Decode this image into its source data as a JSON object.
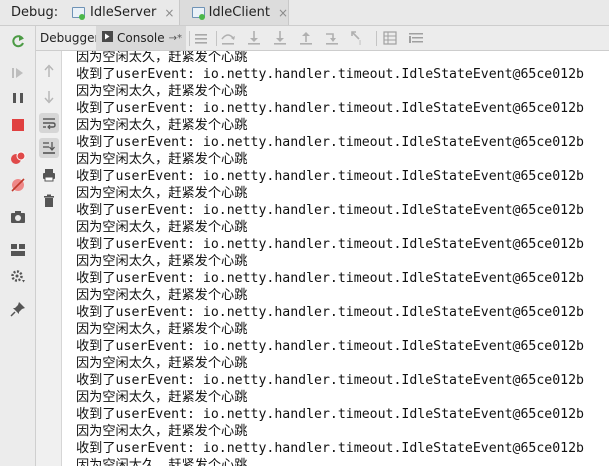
{
  "header": {
    "debug_label": "Debug:",
    "tabs": [
      {
        "label": "IdleServer",
        "active": false
      },
      {
        "label": "IdleClient",
        "active": true
      }
    ],
    "close_glyph": "×"
  },
  "subtoolbar": {
    "debugger_label": "Debugger",
    "console_label": "Console",
    "console_suffix": "→*"
  },
  "console": {
    "lines": [
      "因为空闲太久，赶紧发个心跳",
      "收到了userEvent: io.netty.handler.timeout.IdleStateEvent@65ce012b",
      "因为空闲太久，赶紧发个心跳",
      "收到了userEvent: io.netty.handler.timeout.IdleStateEvent@65ce012b",
      "因为空闲太久，赶紧发个心跳",
      "收到了userEvent: io.netty.handler.timeout.IdleStateEvent@65ce012b",
      "因为空闲太久，赶紧发个心跳",
      "收到了userEvent: io.netty.handler.timeout.IdleStateEvent@65ce012b",
      "因为空闲太久，赶紧发个心跳",
      "收到了userEvent: io.netty.handler.timeout.IdleStateEvent@65ce012b",
      "因为空闲太久，赶紧发个心跳",
      "收到了userEvent: io.netty.handler.timeout.IdleStateEvent@65ce012b",
      "因为空闲太久，赶紧发个心跳",
      "收到了userEvent: io.netty.handler.timeout.IdleStateEvent@65ce012b",
      "因为空闲太久，赶紧发个心跳",
      "收到了userEvent: io.netty.handler.timeout.IdleStateEvent@65ce012b",
      "因为空闲太久，赶紧发个心跳",
      "收到了userEvent: io.netty.handler.timeout.IdleStateEvent@65ce012b",
      "因为空闲太久，赶紧发个心跳",
      "收到了userEvent: io.netty.handler.timeout.IdleStateEvent@65ce012b",
      "因为空闲太久，赶紧发个心跳",
      "收到了userEvent: io.netty.handler.timeout.IdleStateEvent@65ce012b",
      "因为空闲太久，赶紧发个心跳",
      "收到了userEvent: io.netty.handler.timeout.IdleStateEvent@65ce012b",
      "因为空闲太久，赶紧发个心跳"
    ]
  },
  "colors": {
    "resume_green": "#4c9b45",
    "stop_red": "#e04040",
    "breakpoint_red": "#e04a4a",
    "tab_dot_green": "#4bb84b"
  },
  "icons": {
    "left_strip": [
      "rerun-icon",
      "resume-icon",
      "pause-icon",
      "stop-icon",
      "view-breakpoints-icon",
      "mute-breakpoints-icon",
      "camera-icon",
      "layout-icon",
      "settings-icon",
      "pin-icon"
    ],
    "gutter": [
      "up-arrow-icon",
      "down-arrow-icon",
      "soft-wrap-icon",
      "scroll-to-end-icon",
      "print-icon",
      "trash-icon"
    ],
    "toolbar": [
      "restore-layout-icon",
      "step-over-icon",
      "step-into-icon",
      "force-step-into-icon",
      "step-out-icon",
      "run-to-cursor-icon",
      "evaluate-icon",
      "table-icon",
      "frames-icon"
    ]
  }
}
